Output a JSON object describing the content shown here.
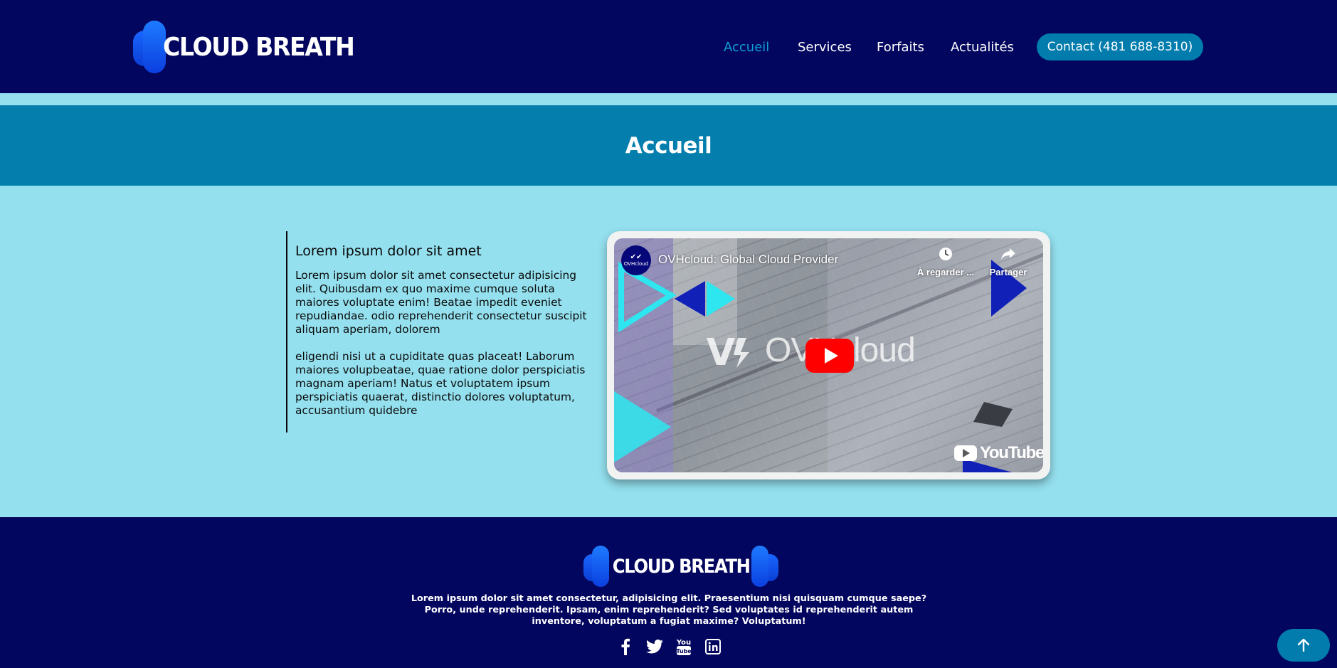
{
  "header": {
    "logo_text": "CLOUD BREATH",
    "nav": [
      {
        "label": "Accueil",
        "active": true
      },
      {
        "label": "Services",
        "active": false
      },
      {
        "label": "Forfaits",
        "active": false
      },
      {
        "label": "Actualités",
        "active": false
      }
    ],
    "contact_label": "Contact (481 688-8310)"
  },
  "page_title": "Accueil",
  "content": {
    "heading": "Lorem ipsum dolor sit amet",
    "paragraph_1": "Lorem ipsum dolor sit amet consectetur adipisicing elit. Quibusdam ex quo maxime cumque soluta maiores voluptate enim! Beatae impedit eveniet repudiandae. odio reprehenderit consectetur suscipit aliquam aperiam, dolorem",
    "paragraph_2": "eligendi nisi ut a cupiditate quas placeat! Laborum maiores volupbeatae, quae ratione dolor perspiciatis magnam aperiam! Natus et voluptatem ipsum perspiciatis quaerat, distinctio dolores voluptatum, accusantium quidebre"
  },
  "video": {
    "title": "OVHcloud: Global Cloud Provider",
    "channel_label": "OVHcloud",
    "watch_later_label": "À regarder ...",
    "share_label": "Partager",
    "brand_word": "OVHcloud",
    "platform_label": "YouTube"
  },
  "footer": {
    "logo_text": "CLOUD BREATH",
    "text": "Lorem ipsum dolor sit amet consectetur, adipisicing elit. Praesentium nisi quisquam cumque saepe? Porro, unde reprehenderit. Ipsam, enim reprehenderit? Sed voluptates id reprehenderit autem inventore, voluptatum a fugiat maxime? Voluptatum!",
    "socials": [
      "facebook-icon",
      "twitter-icon",
      "youtube-icon",
      "linkedin-icon"
    ]
  },
  "colors": {
    "navy": "#03065e",
    "accent": "#017cad",
    "light_bg": "#94e0ee",
    "active_link": "#0ea0d4"
  }
}
